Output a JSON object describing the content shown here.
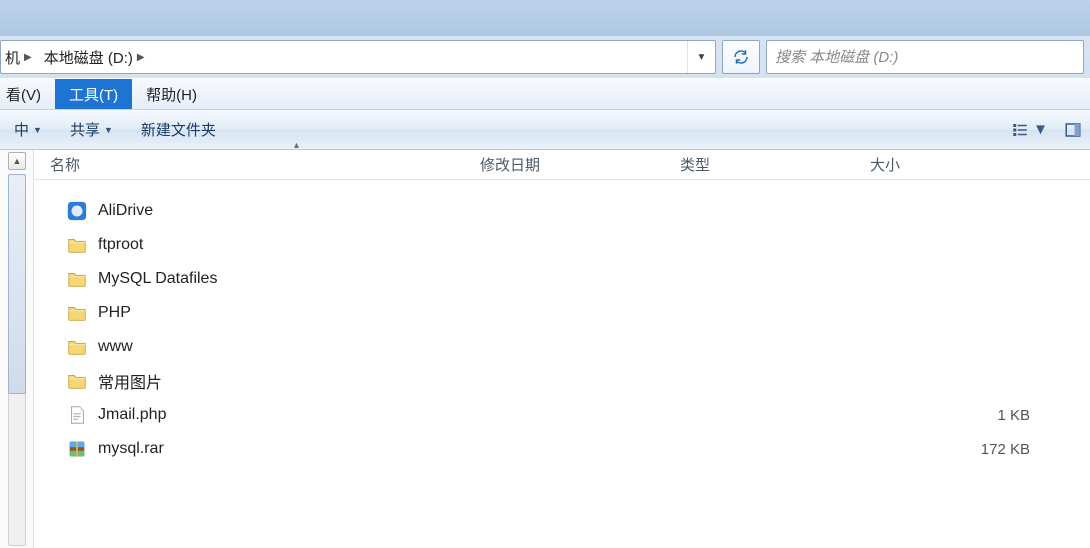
{
  "breadcrumb": {
    "root": "机",
    "current": "本地磁盘 (D:)"
  },
  "address": {
    "dropdown_glyph": "▼"
  },
  "search": {
    "placeholder": "搜索 本地磁盘 (D:)"
  },
  "menu": {
    "view": "看(V)",
    "tools": "工具(T)",
    "help": "帮助(H)"
  },
  "toolbar": {
    "include": "中",
    "share": "共享",
    "new_folder": "新建文件夹"
  },
  "columns": {
    "name": "名称",
    "date": "修改日期",
    "type": "类型",
    "size": "大小"
  },
  "items": [
    {
      "icon": "app",
      "name": "AliDrive",
      "date": "",
      "type": "",
      "size": ""
    },
    {
      "icon": "folder",
      "name": "ftproot",
      "date": "",
      "type": "",
      "size": ""
    },
    {
      "icon": "folder",
      "name": "MySQL Datafiles",
      "date": "",
      "type": "",
      "size": ""
    },
    {
      "icon": "folder",
      "name": "PHP",
      "date": "",
      "type": "",
      "size": ""
    },
    {
      "icon": "folder",
      "name": "www",
      "date": "",
      "type": "",
      "size": ""
    },
    {
      "icon": "folder",
      "name": "常用图片",
      "date": "",
      "type": "",
      "size": ""
    },
    {
      "icon": "file",
      "name": "Jmail.php",
      "date": "",
      "type": "",
      "size": "1 KB"
    },
    {
      "icon": "archive",
      "name": "mysql.rar",
      "date": "",
      "type": "",
      "size": "172 KB"
    }
  ]
}
